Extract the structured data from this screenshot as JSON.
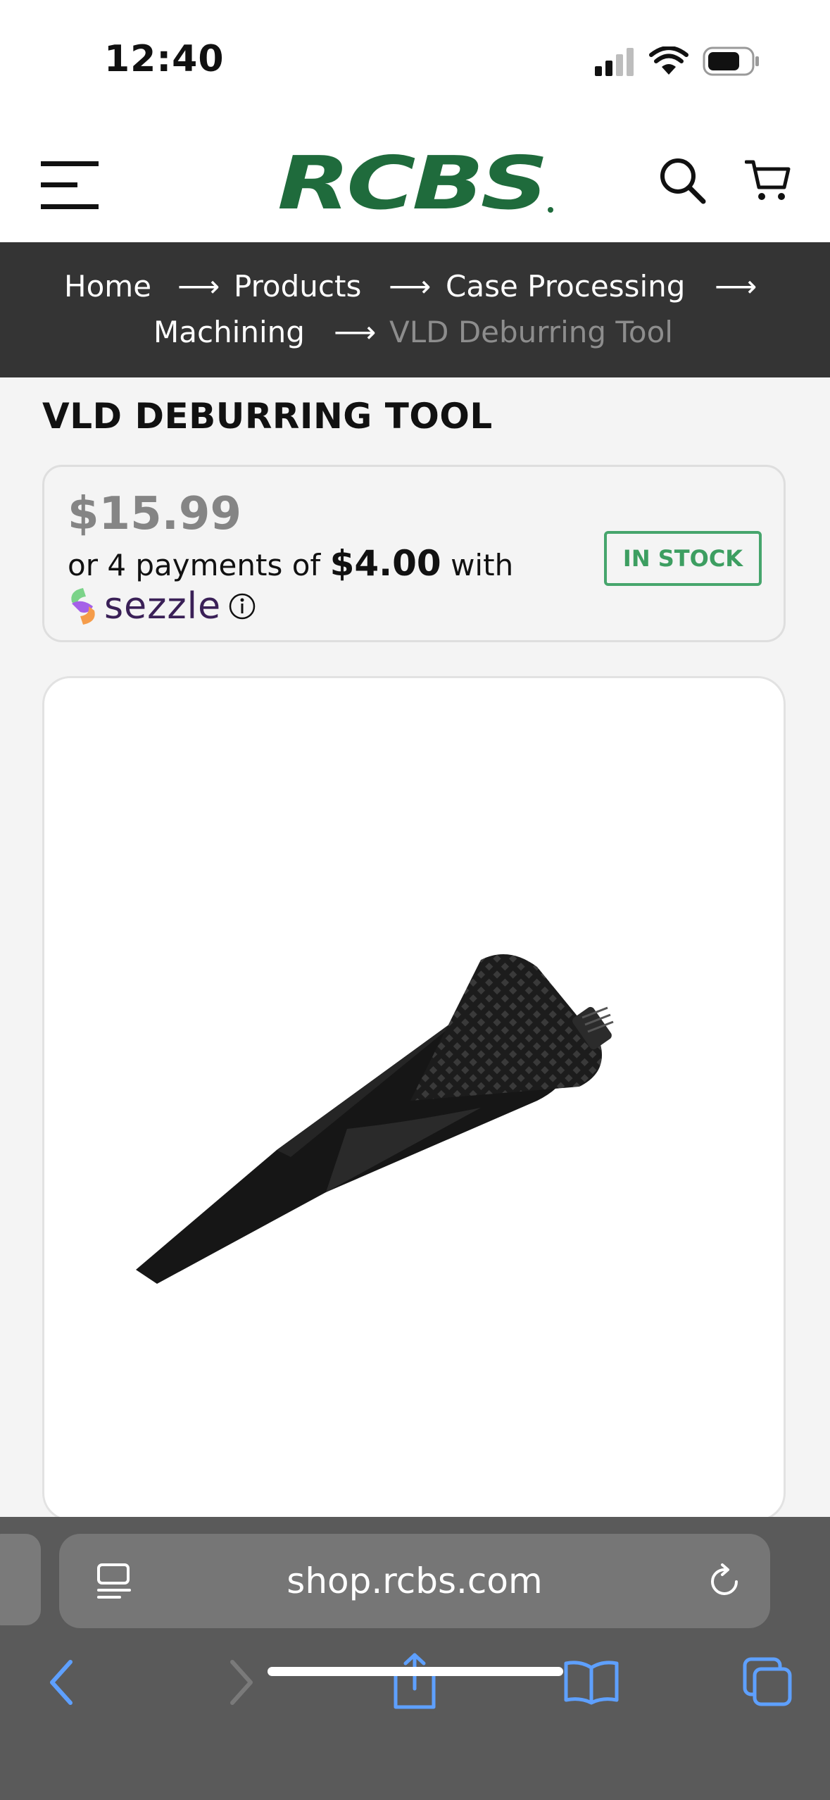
{
  "status_bar": {
    "time": "12:40"
  },
  "header": {
    "brand": "RCBS"
  },
  "breadcrumb": {
    "items": [
      "Home",
      "Products",
      "Case Processing",
      "Machining"
    ],
    "separator": "⟶",
    "current": "VLD Deburring Tool"
  },
  "product": {
    "title": "VLD DEBURRING TOOL",
    "price": "$15.99",
    "installment_prefix": "or 4 payments of",
    "installment_amount": "$4.00",
    "installment_suffix": "with",
    "payment_provider": "sezzle",
    "stock_status": "IN STOCK"
  },
  "browser": {
    "url": "shop.rcbs.com"
  },
  "colors": {
    "brand_green": "#1f6b3c",
    "stock_green": "#46a56c",
    "breadcrumb_bg": "#343434"
  },
  "icons": [
    "menu-icon",
    "search-icon",
    "cart-icon",
    "info-icon",
    "reader-icon",
    "reload-icon",
    "back-icon",
    "forward-icon",
    "share-icon",
    "bookmarks-icon",
    "tabs-icon"
  ]
}
